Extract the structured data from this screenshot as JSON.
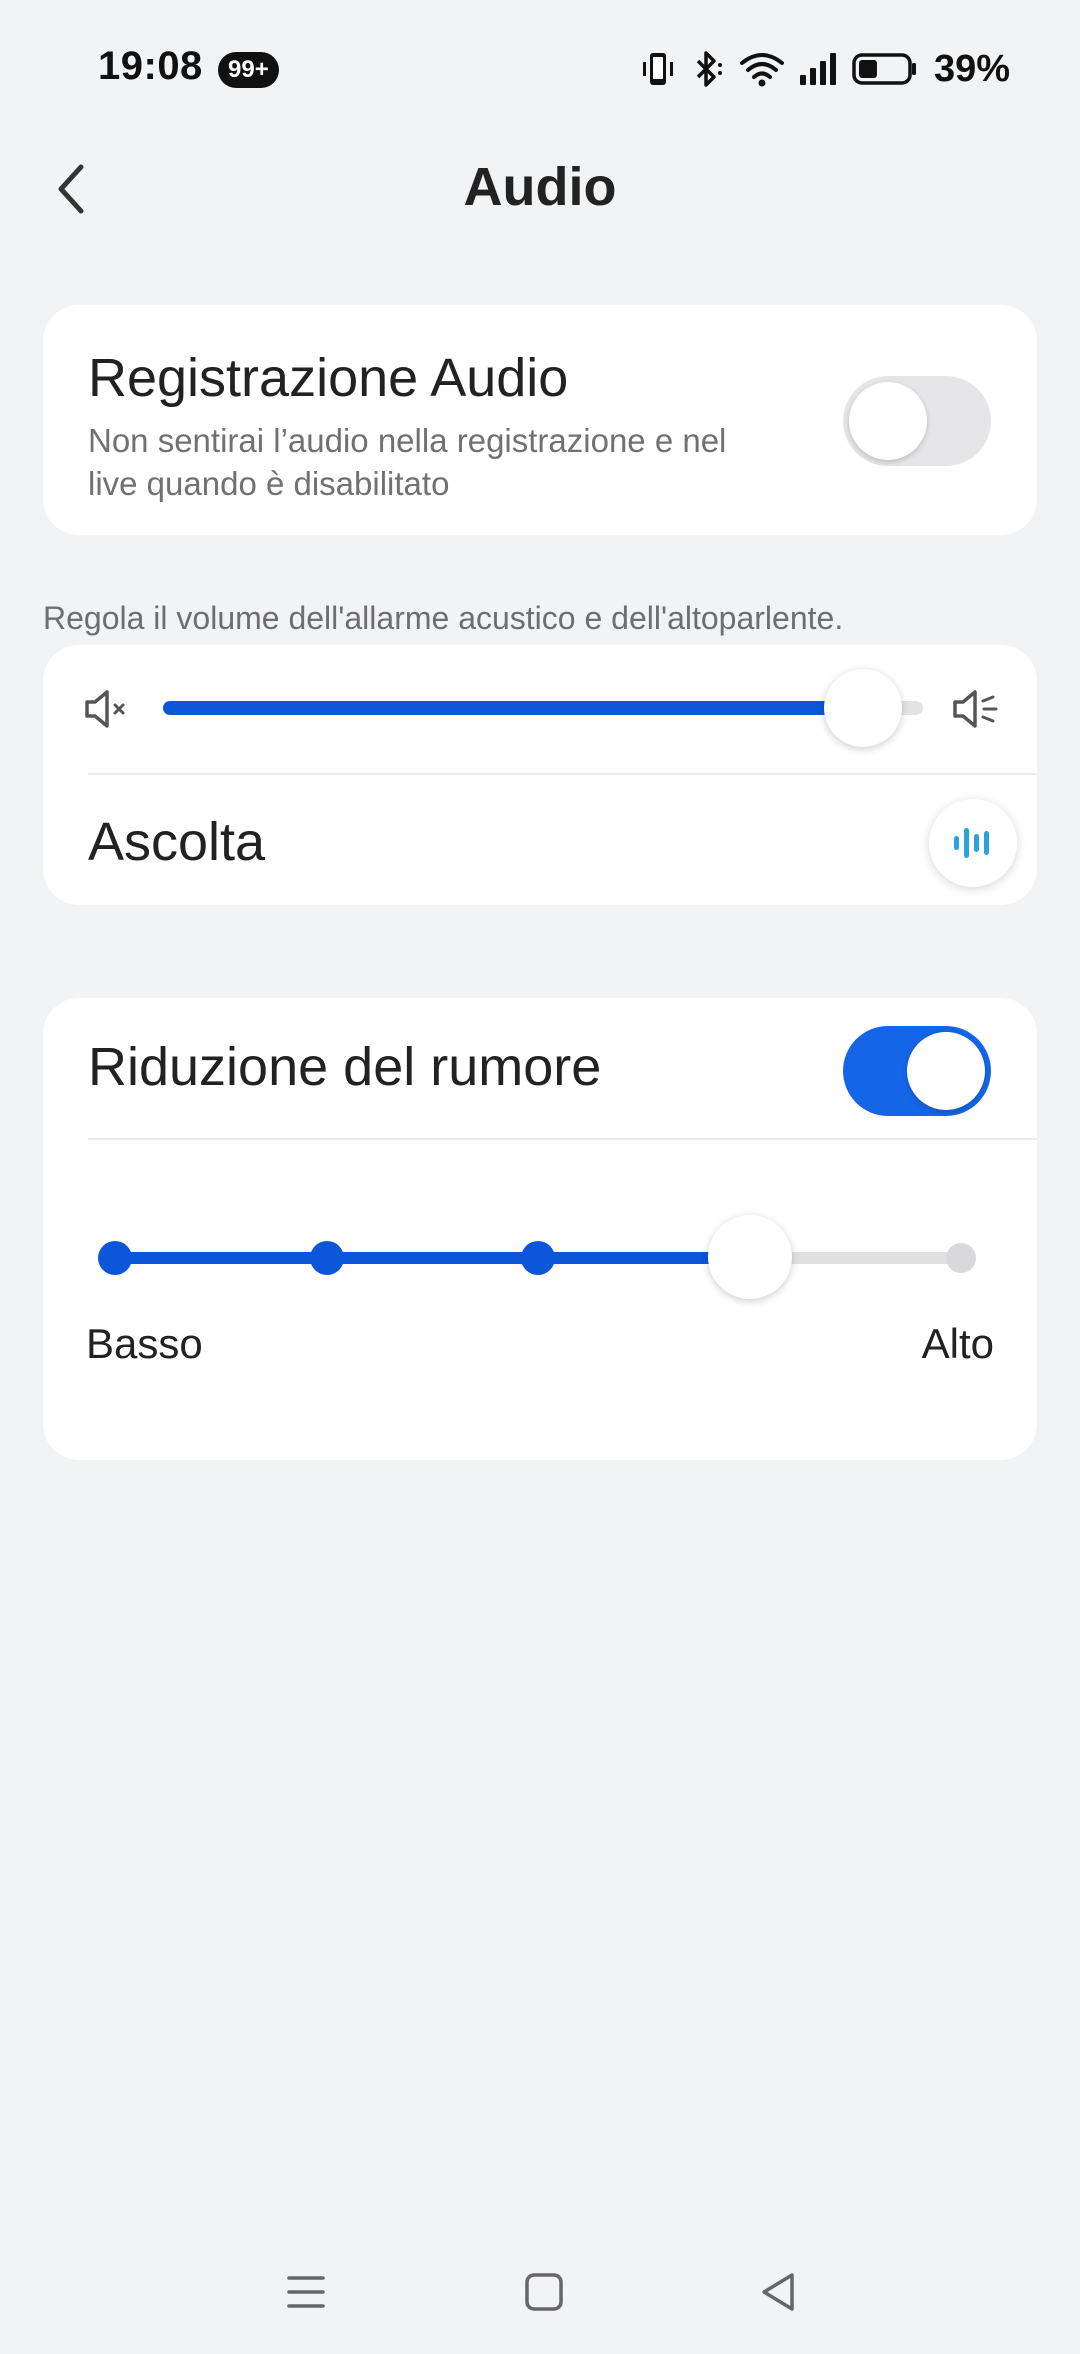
{
  "status_bar": {
    "time": "19:08",
    "notification_badge": "99+",
    "battery_percent": "39%",
    "battery_level": 0.39,
    "icons": [
      "vibrate-icon",
      "bluetooth-icon",
      "wifi-icon",
      "signal-icon",
      "battery-icon"
    ]
  },
  "header": {
    "title": "Audio",
    "back_icon": "chevron-left-icon"
  },
  "audio_recording": {
    "title": "Registrazione Audio",
    "description": "Non sentirai l’audio nella registrazione e nel live quando è disabilitato",
    "enabled": false
  },
  "volume": {
    "hint": "Regola il volume dell'allarme acustico e dell'altoparlente.",
    "level": 1.0,
    "min_icon": "speaker-mute-icon",
    "max_icon": "speaker-loud-icon",
    "listen_label": "Ascolta",
    "listen_icon": "sound-wave-icon"
  },
  "noise_reduction": {
    "title": "Riduzione del rumore",
    "enabled": true,
    "steps": 5,
    "selected_step": 4,
    "low_label": "Basso",
    "high_label": "Alto"
  },
  "colors": {
    "accent": "#0b56d9",
    "toggle_on": "#1465e8",
    "background": "#f2f3f5",
    "card": "#ffffff",
    "listen_icon": "#2aa3dc"
  },
  "nav_bar": {
    "items": [
      "menu-icon",
      "home-icon",
      "back-triangle-icon"
    ]
  }
}
